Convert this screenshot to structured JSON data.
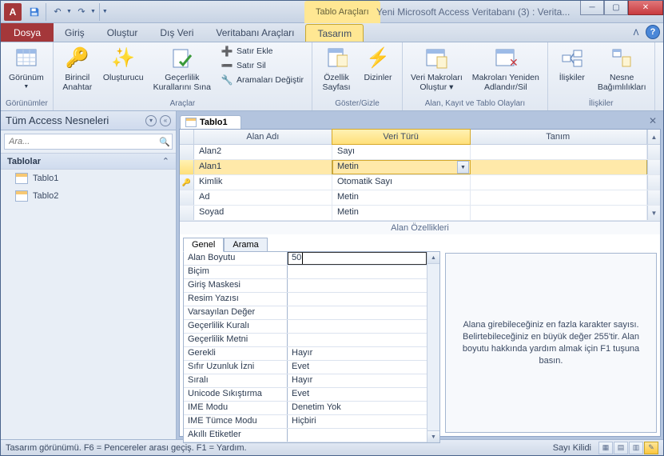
{
  "app_letter": "A",
  "context_tab": "Tablo Araçları",
  "doc_title": "Yeni Microsoft Access Veritabanı (3) : Verita...",
  "menu": {
    "file": "Dosya",
    "tabs": [
      "Giriş",
      "Oluştur",
      "Dış Veri",
      "Veritabanı Araçları",
      "Tasarım"
    ],
    "active": "Tasarım"
  },
  "ribbon": {
    "g1": {
      "label": "Görünümler",
      "view": "Görünüm"
    },
    "g2": {
      "label": "Araçlar",
      "pk": "Birincil\nAnahtar",
      "builder": "Oluşturucu",
      "valid": "Geçerlilik\nKurallarını Sına",
      "ins": "Satır Ekle",
      "del": "Satır Sil",
      "mod": "Aramaları Değiştir"
    },
    "g3": {
      "label": "Göster/Gizle",
      "prop": "Özellik\nSayfası",
      "idx": "Dizinler"
    },
    "g4": {
      "label": "Alan, Kayıt ve Tablo Olayları",
      "dm": "Veri Makroları\nOluştur ▾",
      "rn": "Makroları Yeniden\nAdlandır/Sil"
    },
    "g5": {
      "label": "İlişkiler",
      "rel": "İlişkiler",
      "dep": "Nesne\nBağımlılıkları"
    }
  },
  "nav": {
    "title": "Tüm Access Nesneleri",
    "search_placeholder": "Ara...",
    "group": "Tablolar",
    "items": [
      "Tablo1",
      "Tablo2"
    ]
  },
  "doc_tab": "Tablo1",
  "grid": {
    "cols": [
      "Alan Adı",
      "Veri Türü",
      "Tanım"
    ],
    "rows": [
      {
        "key": "",
        "name": "Alan2",
        "type": "Sayı",
        "desc": "",
        "selected": false
      },
      {
        "key": "",
        "name": "Alan1",
        "type": "Metin",
        "desc": "",
        "selected": true,
        "dropdown": true
      },
      {
        "key": "🔑",
        "name": "Kimlik",
        "type": "Otomatik Sayı",
        "desc": "",
        "selected": false
      },
      {
        "key": "",
        "name": "Ad",
        "type": "Metin",
        "desc": "",
        "selected": false
      },
      {
        "key": "",
        "name": "Soyad",
        "type": "Metin",
        "desc": "",
        "selected": false
      }
    ]
  },
  "props": {
    "heading": "Alan Özellikleri",
    "tabs": [
      "Genel",
      "Arama"
    ],
    "rows": [
      {
        "n": "Alan Boyutu",
        "v": "50",
        "focus": true
      },
      {
        "n": "Biçim",
        "v": ""
      },
      {
        "n": "Giriş Maskesi",
        "v": ""
      },
      {
        "n": "Resim Yazısı",
        "v": ""
      },
      {
        "n": "Varsayılan Değer",
        "v": ""
      },
      {
        "n": "Geçerlilik Kuralı",
        "v": ""
      },
      {
        "n": "Geçerlilik Metni",
        "v": ""
      },
      {
        "n": "Gerekli",
        "v": "Hayır"
      },
      {
        "n": "Sıfır Uzunluk İzni",
        "v": "Evet"
      },
      {
        "n": "Sıralı",
        "v": "Hayır"
      },
      {
        "n": "Unicode Sıkıştırma",
        "v": "Evet"
      },
      {
        "n": "IME Modu",
        "v": "Denetim Yok"
      },
      {
        "n": "IME Tümce Modu",
        "v": "Hiçbiri"
      },
      {
        "n": "Akıllı Etiketler",
        "v": ""
      }
    ],
    "help": "Alana girebileceğiniz en fazla karakter sayısı. Belirtebileceğiniz en büyük değer 255'tir. Alan boyutu hakkında yardım almak için F1 tuşuna basın."
  },
  "status": {
    "left": "Tasarım görünümü.  F6 = Pencereler arası geçiş.  F1 = Yardım.",
    "right": "Sayı Kilidi"
  }
}
